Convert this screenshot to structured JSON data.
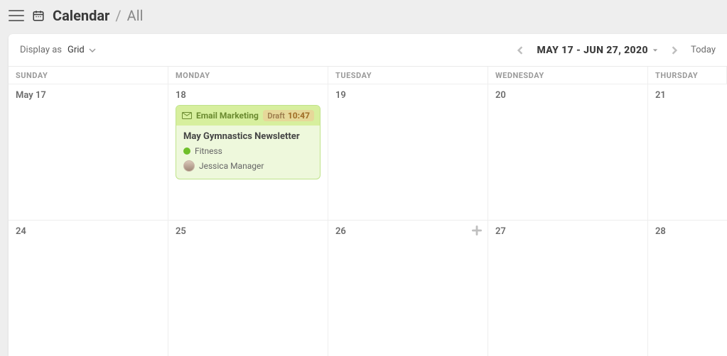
{
  "header": {
    "title": "Calendar",
    "separator": "/",
    "filter": "All"
  },
  "toolbar": {
    "display_label": "Display as",
    "display_value": "Grid",
    "range": "MAY 17 - JUN 27, 2020",
    "today_label": "Today"
  },
  "columns": [
    "SUNDAY",
    "MONDAY",
    "TUESDAY",
    "WEDNESDAY",
    "THURSDAY"
  ],
  "rows": [
    [
      {
        "date": "May 17"
      },
      {
        "date": "18",
        "has_event": true
      },
      {
        "date": "19"
      },
      {
        "date": "20"
      },
      {
        "date": "21"
      }
    ],
    [
      {
        "date": "24"
      },
      {
        "date": "25"
      },
      {
        "date": "26",
        "show_add": true
      },
      {
        "date": "27"
      },
      {
        "date": "28"
      }
    ]
  ],
  "event": {
    "type_label": "Email Marketing",
    "status": "Draft",
    "time": "10:47",
    "title": "May Gymnastics Newsletter",
    "tag": {
      "label": "Fitness",
      "color": "#6fbf2a"
    },
    "assignee": "Jessica Manager"
  }
}
